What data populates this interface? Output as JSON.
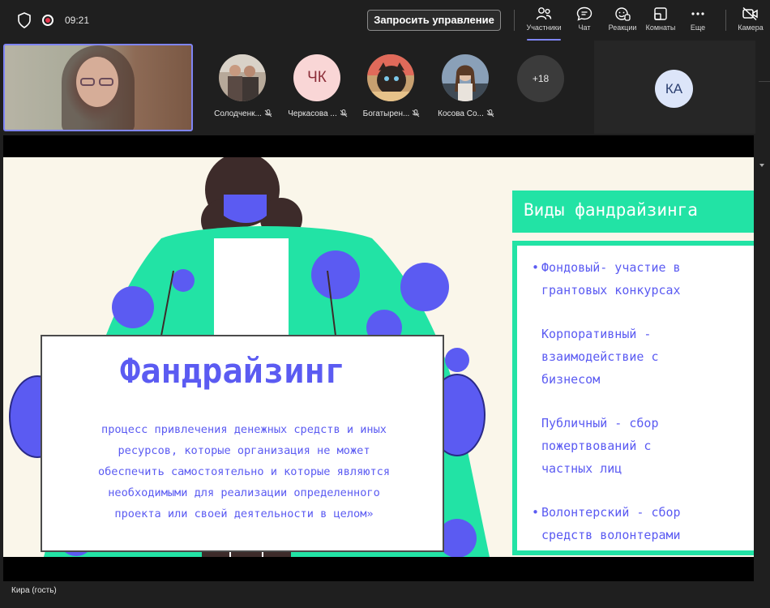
{
  "topbar": {
    "time": "09:21",
    "request_control": "Запросить управление",
    "buttons": {
      "participants": "Участники",
      "chat": "Чат",
      "reactions": "Реакции",
      "rooms": "Комнаты",
      "more": "Еще",
      "camera": "Камера"
    }
  },
  "participants": [
    {
      "label": "Солодченк..."
    },
    {
      "initials": "ЧК",
      "label": "Черкасова ..."
    },
    {
      "label": "Богатырен..."
    },
    {
      "label": "Косова Со..."
    }
  ],
  "more_count": "+18",
  "side_participant": {
    "initials": "КА"
  },
  "presenter": "Кира (гость)",
  "slide": {
    "sign_title": "Фандрайзинг",
    "sign_lines": [
      "процесс привлечения денежных средств и иных",
      "ресурсов, которые организация не может",
      "обеспечить самостоятельно и которые являются",
      "необходимыми для реализации определенного",
      "проекта или своей деятельности в целом»"
    ],
    "types_title": "Виды фандрайзинга",
    "types": [
      {
        "line1": "Фондовый- участие в",
        "line2": "грантовых конкурсах"
      },
      {
        "line1": "Корпоративный -",
        "line2": "взаимодействие с",
        "line3": "бизнесом"
      },
      {
        "line1": "Публичный - сбор",
        "line2": "пожертвований с",
        "line3": "частных лиц"
      },
      {
        "line1": "Волонтерский - сбор",
        "line2": "средств волонтерами"
      }
    ]
  },
  "colors": {
    "accent": "#7f85f5",
    "slide_blue": "#5b5bf2",
    "slide_green": "#22e3a5",
    "record_red": "#e8384f"
  }
}
